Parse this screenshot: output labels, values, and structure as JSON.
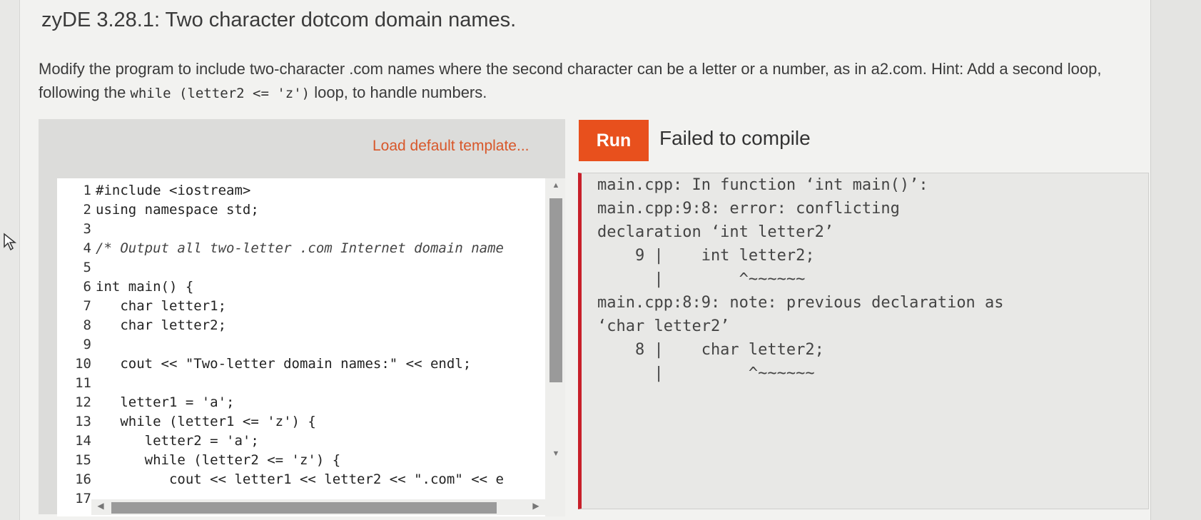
{
  "title": "zyDE 3.28.1: Two character dotcom domain names.",
  "instructions": {
    "part1": "Modify the program to include two-character .com names where the second character can be a letter or a number, as in a2.com. Hint: Add a second loop, following the ",
    "code": "while (letter2 <= 'z')",
    "part2": " loop, to handle numbers."
  },
  "editor": {
    "load_template_label": "Load default template...",
    "line_numbers": [
      "1",
      "2",
      "3",
      "4",
      "5",
      "6",
      "7",
      "8",
      "9",
      "10",
      "11",
      "12",
      "13",
      "14",
      "15",
      "16",
      "17"
    ],
    "lines": [
      "#include <iostream>",
      "using namespace std;",
      "",
      "/* Output all two-letter .com Internet domain name",
      "",
      "int main() {",
      "   char letter1;",
      "   char letter2;",
      "",
      "   cout << \"Two-letter domain names:\" << endl;",
      "",
      "   letter1 = 'a';",
      "   while (letter1 <= 'z') {",
      "      letter2 = 'a';",
      "      while (letter2 <= 'z') {",
      "         cout << letter1 << letter2 << \".com\" << e",
      ""
    ]
  },
  "run": {
    "button_label": "Run",
    "status": "Failed to compile"
  },
  "output": {
    "lines": [
      "main.cpp: In function ‘int main()’:",
      "main.cpp:9:8: error: conflicting",
      "declaration ‘int letter2’",
      "    9 |    int letter2;",
      "      |        ^~~~~~~",
      "main.cpp:8:9: note: previous declaration as",
      "‘char letter2’",
      "    8 |    char letter2;",
      "      |         ^~~~~~~"
    ]
  },
  "colors": {
    "accent": "#e8501d",
    "error_border": "#c8202a",
    "link": "#d8572a"
  },
  "icons": {
    "cursor": "mouse-pointer-icon",
    "scroll_up": "triangle-up-icon",
    "scroll_down": "triangle-down-icon",
    "scroll_left": "triangle-left-icon",
    "scroll_right": "triangle-right-icon"
  }
}
